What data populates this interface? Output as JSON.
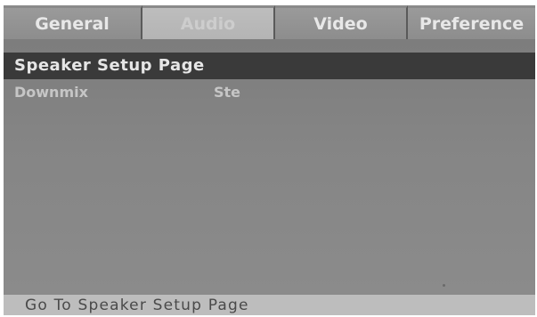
{
  "tabs": [
    {
      "label": "General",
      "active": false
    },
    {
      "label": "Audio",
      "active": true
    },
    {
      "label": "Video",
      "active": false
    },
    {
      "label": "Preference",
      "active": false
    }
  ],
  "page": {
    "title": "Speaker Setup Page"
  },
  "options": [
    {
      "label": "Downmix",
      "value": "Ste"
    }
  ],
  "status": {
    "text": "Go To Speaker Setup Page"
  },
  "colors": {
    "screen_bg": "#858585",
    "header_bg": "#3a3a3a",
    "active_tab_bg": "#b8b8b8",
    "status_bg": "#bdbdbd"
  }
}
